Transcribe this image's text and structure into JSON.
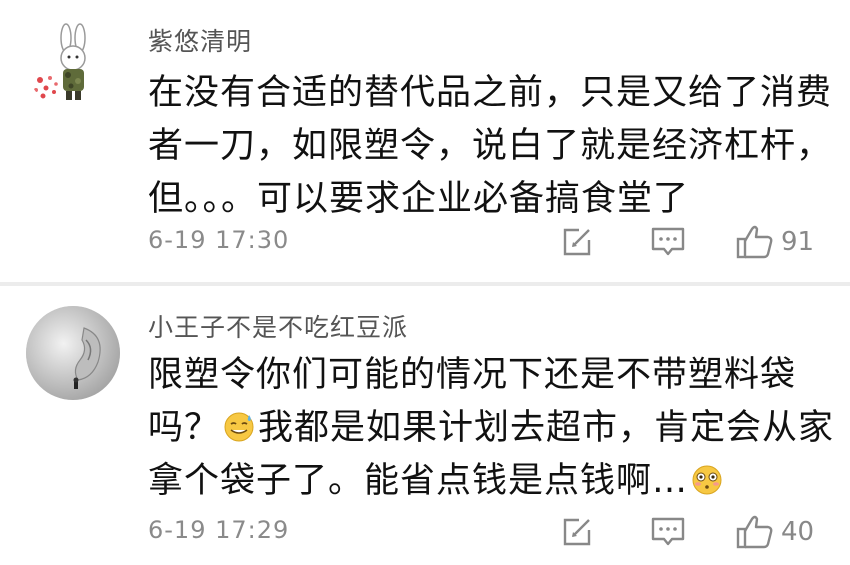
{
  "comments": [
    {
      "username": "紫悠清明",
      "text_parts": [
        "在没有合适的替代品之前，只是又给了消费者一刀，如限塑令，说白了就是经济杠杆，但。。。可以要求企业必备搞食堂了"
      ],
      "time": "6-19 17:30",
      "likes": "91",
      "avatar_icon": "bunny-avatar-icon"
    },
    {
      "username": "小王子不是不吃红豆派",
      "text_parts": [
        "限塑令你们可能的情况下还是不带塑料袋吗？",
        "我都是如果计划去超市，肯定会从家拿个袋子了。能省点钱是点钱啊…"
      ],
      "time": "6-19 17:29",
      "likes": "40",
      "avatar_icon": "ear-earring-avatar-icon"
    }
  ],
  "icons": {
    "repost": "repost-icon",
    "comment": "comment-icon",
    "like": "thumbs-up-icon",
    "emoji_sweat": "sweat-smile-emoji-icon",
    "emoji_flushed": "flushed-emoji-icon"
  },
  "colors": {
    "username": "#555555",
    "text": "#111111",
    "meta": "#8a8a8a",
    "icon": "#888888",
    "divider": "#ececec"
  }
}
